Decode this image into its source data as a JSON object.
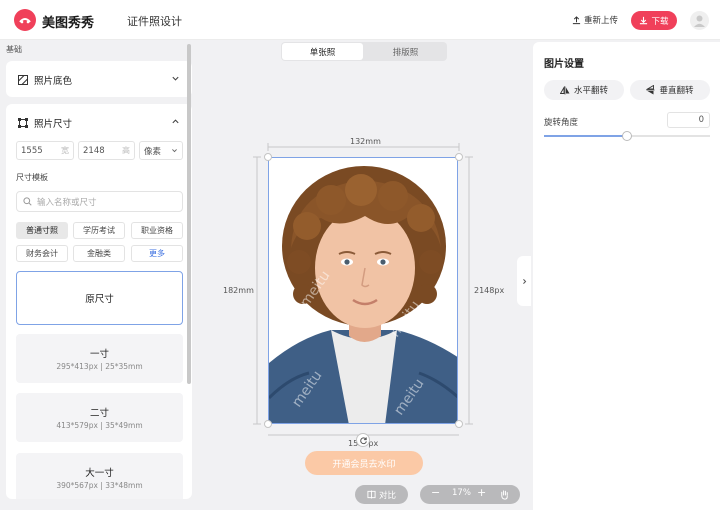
{
  "header": {
    "brand": "美图秀秀",
    "app_title": "证件照设计",
    "reupload_label": "重新上传",
    "download_label": "下载"
  },
  "left_panel": {
    "section_label": "基础",
    "background_card": {
      "title": "照片底色"
    },
    "size_card": {
      "title": "照片尺寸",
      "width_value": "1555",
      "width_unit": "宽",
      "height_value": "2148",
      "height_unit": "高",
      "unit_select": "像素",
      "template_label": "尺寸模板",
      "search_placeholder": "输入名称或尺寸",
      "chips": [
        "普通寸照",
        "学历考试",
        "职业资格",
        "财务会计",
        "金融类",
        "更多"
      ],
      "active_chip": "普通寸照",
      "tiles": [
        {
          "name": "原尺寸",
          "desc": ""
        },
        {
          "name": "一寸",
          "desc": "295*413px | 25*35mm"
        },
        {
          "name": "二寸",
          "desc": "413*579px | 35*49mm"
        },
        {
          "name": "大一寸",
          "desc": "390*567px | 33*48mm"
        }
      ]
    }
  },
  "canvas": {
    "tabs": [
      "单张照",
      "排版照"
    ],
    "active_tab": "单张照",
    "top_dimension": "132mm",
    "left_dimension": "182mm",
    "right_dimension": "2148px",
    "bottom_dimension": "1555px",
    "watermark": "meitu",
    "vip_button": "开通会员去水印",
    "compare_label": "对比",
    "zoom": {
      "level": "17%",
      "minus": "−",
      "plus": "+"
    }
  },
  "right_panel": {
    "title": "图片设置",
    "flip_horizontal": "水平翻转",
    "flip_vertical": "垂直翻转",
    "rotation_label": "旋转角度",
    "rotation_value": "0",
    "rotation_slider_fraction": 0.5
  },
  "colors": {
    "accent": "#f0405a",
    "selection": "#7fa3e6",
    "vip_button": "#fbc9a6"
  }
}
